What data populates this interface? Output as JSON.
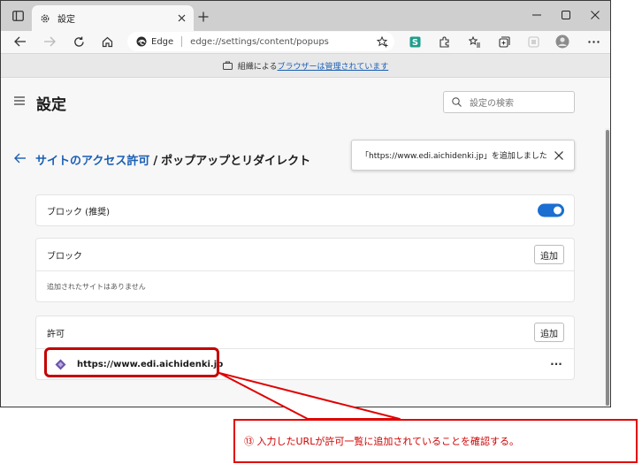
{
  "tab": {
    "title": "設定"
  },
  "address": {
    "brand": "Edge",
    "url": "edge://settings/content/popups"
  },
  "banner": {
    "prefix": "組織による",
    "link": "ブラウザーは管理されています"
  },
  "header": {
    "title": "設定",
    "search_placeholder": "設定の検索"
  },
  "breadcrumb": {
    "parent": "サイトのアクセス許可",
    "separator": "/",
    "current": "ポップアップとリダイレクト"
  },
  "toast": {
    "message": "「https://www.edi.aichidenki.jp」を追加しました"
  },
  "sections": {
    "block_recommended": {
      "label": "ブロック (推奨)",
      "toggle_on": true
    },
    "block": {
      "label": "ブロック",
      "add_label": "追加",
      "empty_text": "追加されたサイトはありません"
    },
    "allow": {
      "label": "許可",
      "add_label": "追加",
      "site_url": "https://www.edi.aichidenki.jp",
      "more_label": "···"
    }
  },
  "annotation": {
    "text": "⑬ 入力したURLが許可一覧に追加されていることを確認する。"
  },
  "colors": {
    "accent": "#1a6fd0",
    "link": "#1a5fb4",
    "annotation": "#e10000"
  }
}
